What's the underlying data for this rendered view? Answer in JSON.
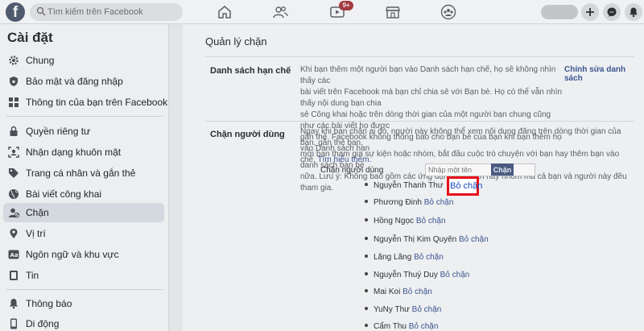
{
  "topbar": {
    "logo": "f",
    "search_placeholder": "Tìm kiếm trên Facebook",
    "nav_icons": [
      "home-icon",
      "friends-icon",
      "watch-icon",
      "marketplace-icon",
      "groups-icon"
    ],
    "watch_badge": "9+",
    "right_icons": [
      "plus-icon",
      "messenger-icon",
      "notification-bell-icon"
    ]
  },
  "sidebar": {
    "title": "Cài đặt",
    "items": [
      {
        "label": "Chung",
        "icon": "gear-icon"
      },
      {
        "label": "Bảo mật và đăng nhập",
        "icon": "shield-icon"
      },
      {
        "label": "Thông tin của bạn trên Facebook",
        "icon": "facebook-info-icon"
      },
      {
        "label": "Quyền riêng tư",
        "icon": "lock-icon"
      },
      {
        "label": "Nhận dạng khuôn mặt",
        "icon": "face-recognition-icon"
      },
      {
        "label": "Trang cá nhân và gắn thẻ",
        "icon": "tag-icon"
      },
      {
        "label": "Bài viết công khai",
        "icon": "globe-icon"
      },
      {
        "label": "Chặn",
        "icon": "block-user-icon"
      },
      {
        "label": "Vị trí",
        "icon": "location-pin-icon"
      },
      {
        "label": "Ngôn ngữ và khu vực",
        "icon": "language-icon"
      },
      {
        "label": "Tin",
        "icon": "stories-icon"
      },
      {
        "label": "Thông báo",
        "icon": "bell-icon"
      },
      {
        "label": "Di động",
        "icon": "mobile-icon"
      }
    ],
    "active_index": 7
  },
  "main": {
    "title": "Quản lý chặn",
    "restricted": {
      "title": "Danh sách hạn chế",
      "line1": "Khi bạn thêm một người bạn vào Danh sách hạn chế, họ sẽ không nhìn thấy các",
      "line2": "bài viết trên Facebook mà bạn chỉ chia sẻ với Bạn bè. Họ có thể vẫn nhìn thấy nội dung bạn chia",
      "line3": "sẻ Công khai hoặc trên dòng thời gian của một người bạn chung cũng như các bài viết họ được",
      "line4": "gắn thẻ. Facebook không thông báo cho bạn bè của bạn khi bạn thêm họ vào Danh sách hạn",
      "line5": "chế.",
      "learn_more": "Tìm hiểu thêm.",
      "edit_link": "Chỉnh sửa danh sách"
    },
    "block_users": {
      "title": "Chặn người dùng",
      "line1": "Ngay khi bạn chặn ai đó, người này không thể xem nội dung đăng trên dòng thời gian của bạn, gắn thẻ bạn,",
      "line2": "mời bạn tham gia sự kiện hoặc nhóm, bắt đầu cuộc trò chuyện với bạn hay thêm bạn vào danh sách bạn bè",
      "line3": "nữa. Lưu ý: Không bao gồm các ứng dụng, trò chơi hay nhóm mà cả bạn và người này đều tham gia.",
      "input_label": "Chặn người dùng",
      "input_placeholder": "Nhập một tên",
      "button_label": "Chặn",
      "unblock_label": "Bỏ chặn",
      "blocked_list": [
        "Nguyễn Thanh Thư",
        "Phương Đinh",
        "Hồng Ngọc",
        "Nguyễn Thị Kim Quyên",
        "Lăng Lăng",
        "Nguyễn Thuý Duy",
        "Mai Koi",
        "YuNy Thư",
        "Cẩm Thu"
      ]
    }
  },
  "colors": {
    "facebook_blue": "#3b5590",
    "highlight_red": "#e8101a",
    "badge_red": "#a23a41"
  }
}
